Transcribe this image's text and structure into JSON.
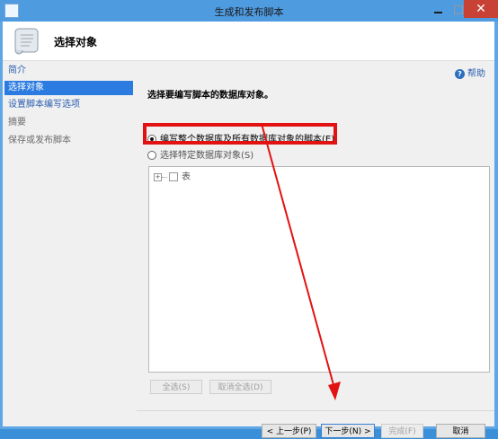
{
  "window": {
    "title": "生成和发布脚本",
    "close_glyph": "✕"
  },
  "header": {
    "title": "选择对象",
    "icon": "scroll-icon"
  },
  "sidebar": {
    "items": [
      {
        "label": "简介"
      },
      {
        "label": "选择对象"
      },
      {
        "label": "设置脚本编写选项"
      },
      {
        "label": "摘要"
      },
      {
        "label": "保存或发布脚本"
      }
    ]
  },
  "main": {
    "help_label": "帮助",
    "help_glyph": "?",
    "instruction": "选择要编写脚本的数据库对象。",
    "option_all": "编写整个数据库及所有数据库对象的脚本(E)",
    "option_specific": "选择特定数据库对象(S)",
    "tree": {
      "expander": "+",
      "item": "表"
    },
    "select_all": "全选(S)",
    "deselect_all": "取消全选(D)"
  },
  "footer": {
    "prev": "< 上一步(P)",
    "next": "下一步(N) >",
    "finish": "完成(F)",
    "cancel": "取消"
  },
  "colors": {
    "accent": "#2b7be0",
    "annotation": "#e21212"
  }
}
